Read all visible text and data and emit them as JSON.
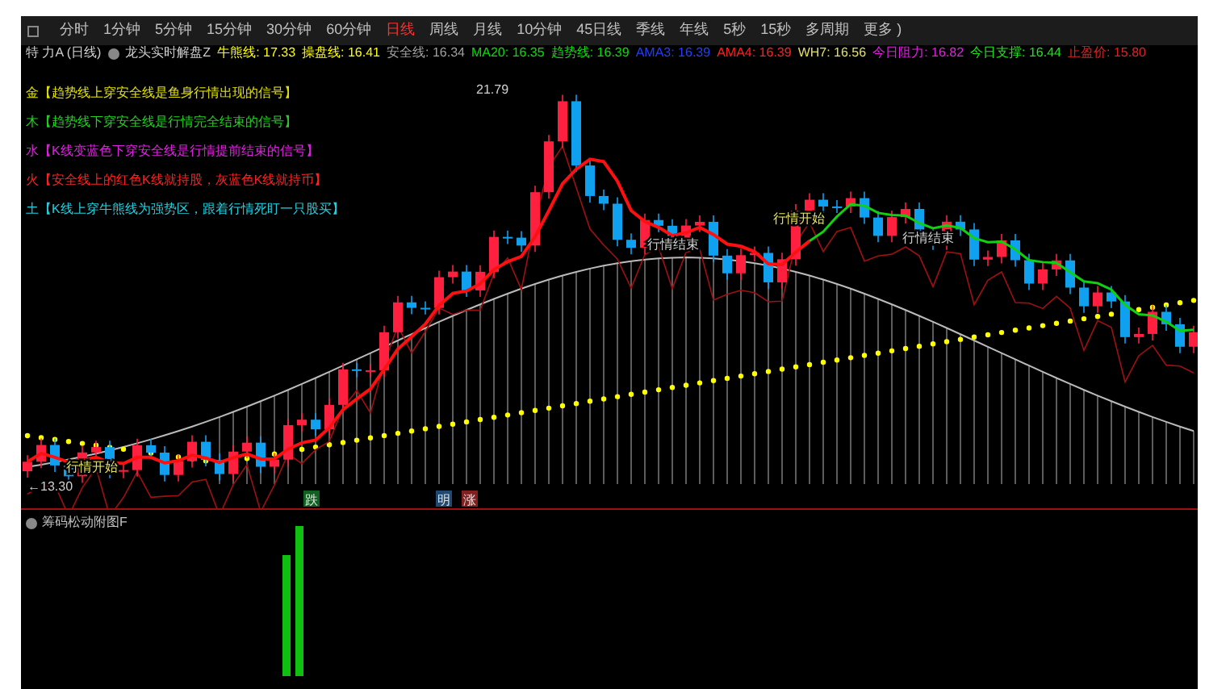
{
  "toolbar": {
    "items": [
      {
        "label": "分时",
        "selected": false
      },
      {
        "label": "1分钟",
        "selected": false
      },
      {
        "label": "5分钟",
        "selected": false
      },
      {
        "label": "15分钟",
        "selected": false
      },
      {
        "label": "30分钟",
        "selected": false
      },
      {
        "label": "60分钟",
        "selected": false
      },
      {
        "label": "日线",
        "selected": true
      },
      {
        "label": "周线",
        "selected": false
      },
      {
        "label": "月线",
        "selected": false
      },
      {
        "label": "10分钟",
        "selected": false
      },
      {
        "label": "45日线",
        "selected": false
      },
      {
        "label": "季线",
        "selected": false
      },
      {
        "label": "年线",
        "selected": false
      },
      {
        "label": "5秒",
        "selected": false
      },
      {
        "label": "15秒",
        "selected": false
      },
      {
        "label": "多周期",
        "selected": false
      },
      {
        "label": "更多 )",
        "selected": false
      }
    ]
  },
  "header": {
    "stock": "特 力A (日线)",
    "indicator": "龙头实时解盘Z",
    "values": [
      {
        "label": "牛熊线: 17.33",
        "color": "#ffff00"
      },
      {
        "label": "操盘线: 16.41",
        "color": "#ffff00"
      },
      {
        "label": "安全线: 16.34",
        "color": "#a0a0a0"
      },
      {
        "label": "MA20: 16.35",
        "color": "#00e000"
      },
      {
        "label": "趋势线: 16.39",
        "color": "#00e000"
      },
      {
        "label": "AMA3: 16.39",
        "color": "#2040ff"
      },
      {
        "label": "AMA4: 16.39",
        "color": "#ff2020"
      },
      {
        "label": "WH7: 16.56",
        "color": "#e0e060"
      },
      {
        "label": "今日阻力: 16.82",
        "color": "#e020e0"
      },
      {
        "label": "今日支撑: 16.44",
        "color": "#20e020"
      },
      {
        "label": "止盈价: 15.80",
        "color": "#e02020"
      }
    ]
  },
  "signals": [
    {
      "text": "金【趋势线上穿安全线是鱼身行情出现的信号】",
      "color": "#e0e000"
    },
    {
      "text": "木【趋势线下穿安全线是行情完全结束的信号】",
      "color": "#20d020"
    },
    {
      "text": "水【K线变蓝色下穿安全线是行情提前结束的信号】",
      "color": "#e020e0"
    },
    {
      "text": "火【安全线上的红色K线就持股，灰蓝色K线就持币】",
      "color": "#ff2020"
    },
    {
      "text": "土【K线上穿牛熊线为强势区，跟着行情死盯一只股买】",
      "color": "#20d0e0"
    }
  ],
  "chart_labels": [
    {
      "text": "21.79",
      "kind": "price"
    },
    {
      "text": "←13.30",
      "kind": "price"
    },
    {
      "text": "行情开始",
      "kind": "start"
    },
    {
      "text": "行情开始",
      "kind": "start"
    },
    {
      "text": "行情结束",
      "kind": "end"
    },
    {
      "text": "行情结束",
      "kind": "end"
    },
    {
      "text": "跌",
      "kind": "down"
    },
    {
      "text": "明",
      "kind": "neutral"
    },
    {
      "text": "涨",
      "kind": "up"
    }
  ],
  "sub_panel": {
    "title": "筹码松动附图F"
  }
}
